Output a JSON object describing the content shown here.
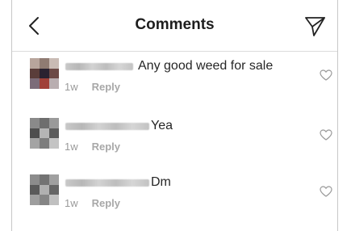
{
  "header": {
    "title": "Comments",
    "back_icon": "chevron-left-icon",
    "send_icon": "paper-plane-icon"
  },
  "comments": [
    {
      "text": "Any good weed for sale",
      "time": "1w",
      "reply": "Reply"
    },
    {
      "text": "Yea",
      "time": "1w",
      "reply": "Reply"
    },
    {
      "text": "Dm",
      "time": "1w",
      "reply": "Reply"
    }
  ],
  "colors": {
    "text": "#262626",
    "meta": "#9a9a9a",
    "divider": "#dbdbdb"
  }
}
